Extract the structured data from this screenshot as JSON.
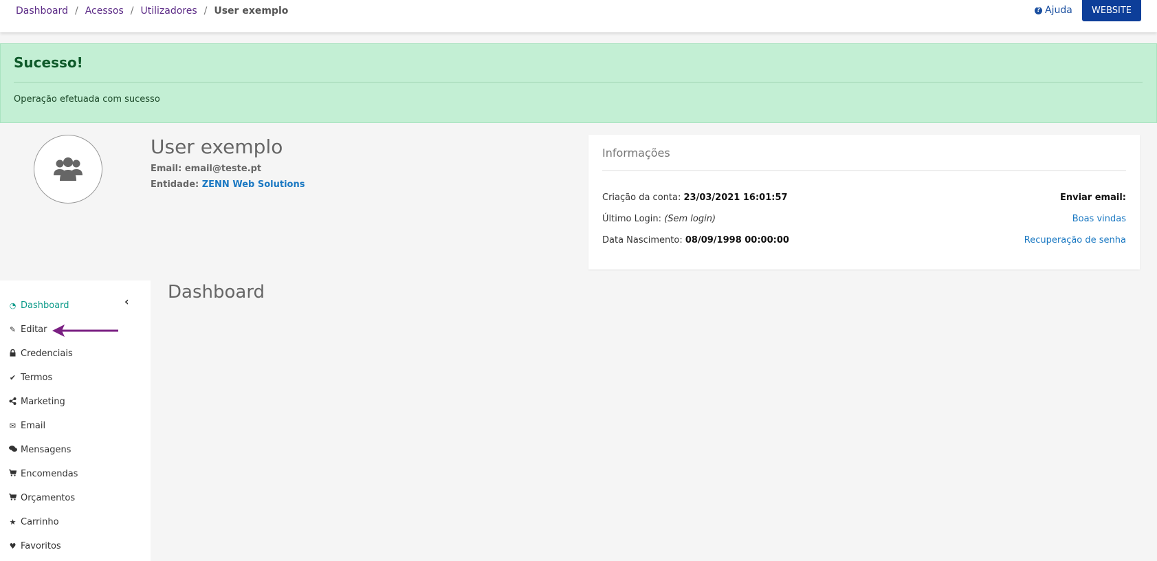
{
  "breadcrumb": {
    "items": [
      "Dashboard",
      "Acessos",
      "Utilizadores"
    ],
    "current": "User exemplo",
    "separator": "/"
  },
  "topbar": {
    "help_label": "Ajuda",
    "website_label": "WEBSITE"
  },
  "alert": {
    "title": "Sucesso!",
    "message": "Operação efetuada com sucesso"
  },
  "profile": {
    "name": "User exemplo",
    "email_label": "Email:",
    "email": "email@teste.pt",
    "entity_label": "Entidade:",
    "entity": "ZENN Web Solutions"
  },
  "info": {
    "title": "Informações",
    "created_label": "Criação da conta:",
    "created_value": "23/03/2021 16:01:57",
    "last_login_label": "Último Login:",
    "last_login_value": "(Sem login)",
    "birth_label": "Data Nascimento:",
    "birth_value": "08/09/1998 00:00:00",
    "send_email_label": "Enviar email:",
    "welcome_link": "Boas vindas",
    "recovery_link": "Recuperação de senha"
  },
  "sidebar": {
    "items": [
      {
        "label": "Dashboard",
        "icon": "dashboard-icon"
      },
      {
        "label": "Editar",
        "icon": "pencil-icon"
      },
      {
        "label": "Credenciais",
        "icon": "lock-icon"
      },
      {
        "label": "Termos",
        "icon": "check-icon"
      },
      {
        "label": "Marketing",
        "icon": "share-icon"
      },
      {
        "label": "Email",
        "icon": "envelope-icon"
      },
      {
        "label": "Mensagens",
        "icon": "comments-icon"
      },
      {
        "label": "Encomendas",
        "icon": "cart-icon"
      },
      {
        "label": "Orçamentos",
        "icon": "cart-icon"
      },
      {
        "label": "Carrinho",
        "icon": "star-icon"
      },
      {
        "label": "Favoritos",
        "icon": "heart-icon"
      }
    ]
  },
  "main": {
    "title": "Dashboard"
  },
  "colors": {
    "brand_purple": "#5b2a86",
    "website_button": "#0d3e99",
    "success_bg": "#c3efd4",
    "active_nav": "#0e9b8a",
    "link_blue": "#1a78c2",
    "arrow": "#7a1f82"
  }
}
